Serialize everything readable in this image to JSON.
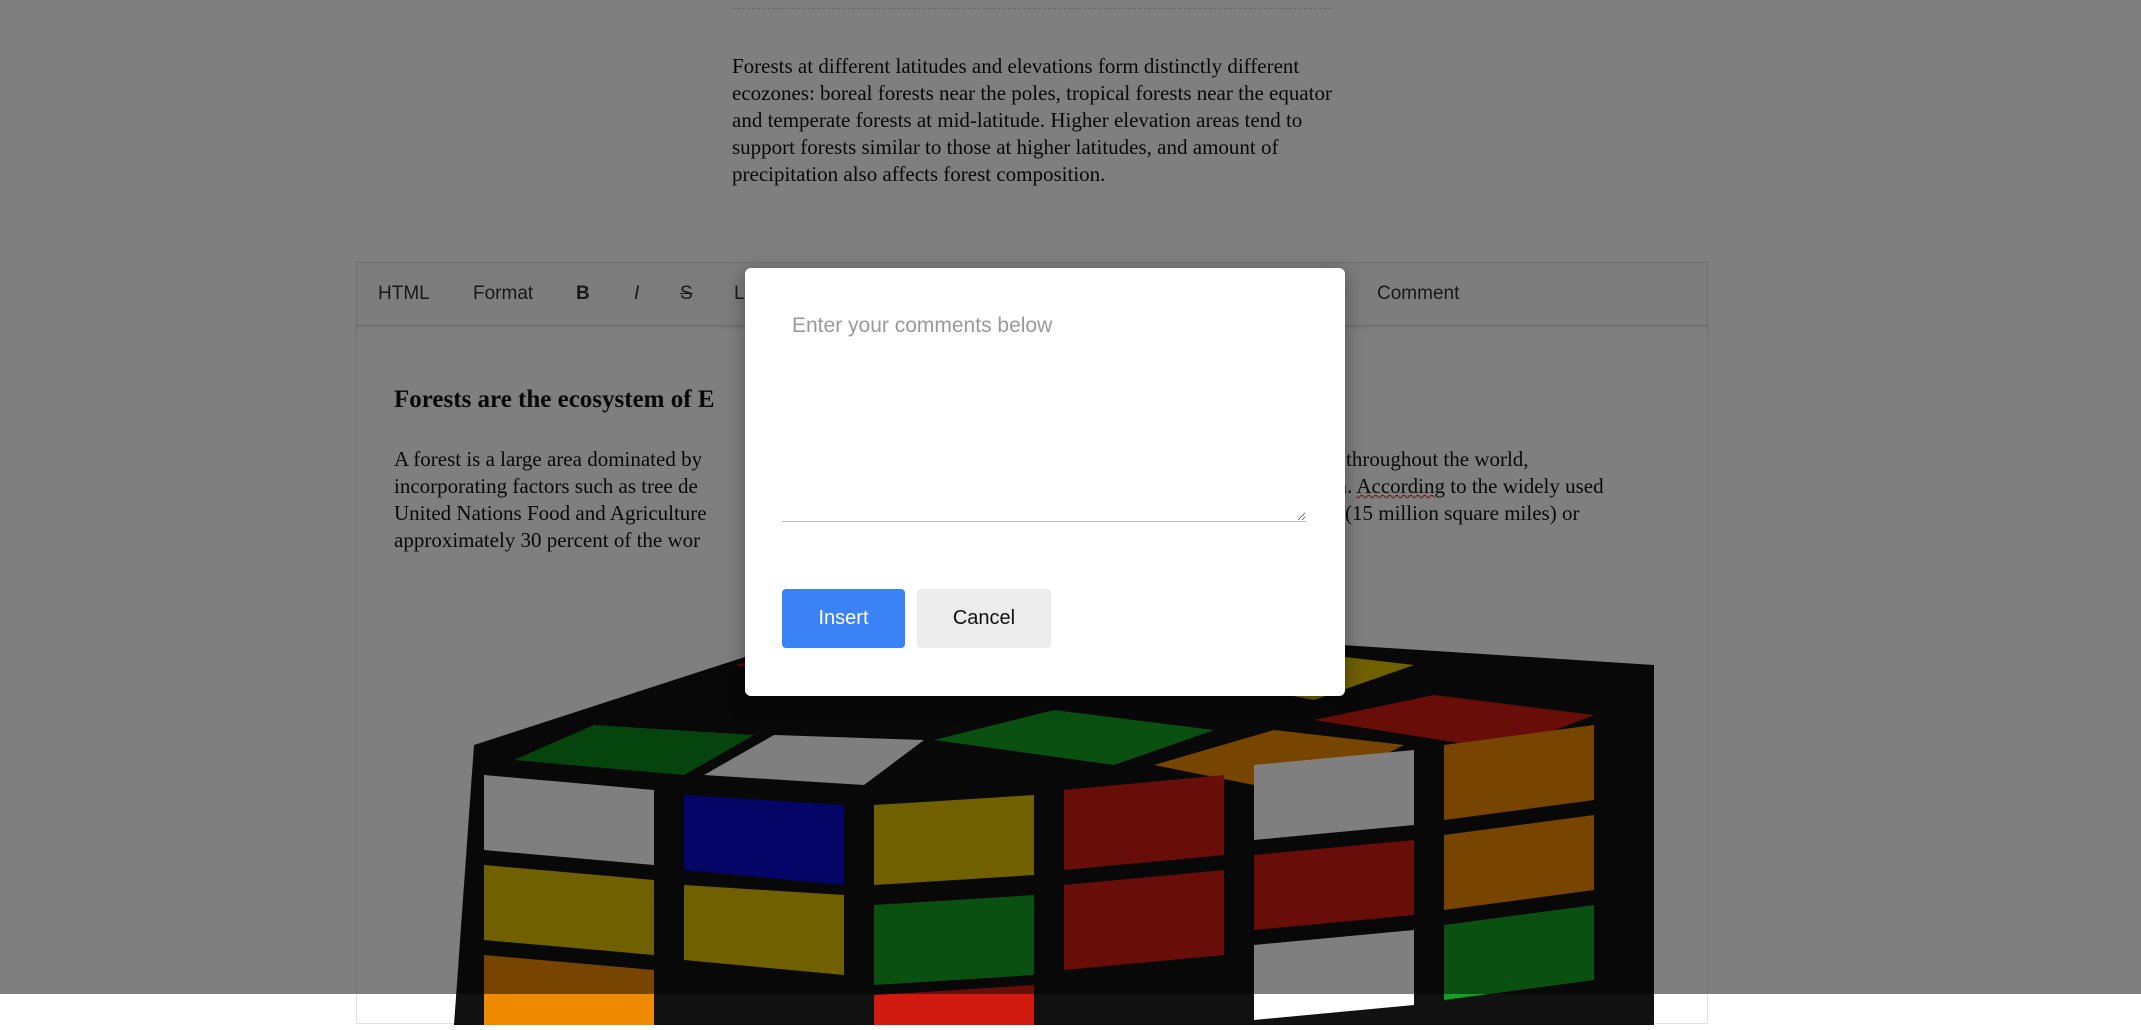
{
  "intro_paragraph": "Forests at different latitudes and elevations form distinctly different ecozones: boreal forests near the poles, tropical forests near the equator and temperate forests at mid-latitude. Higher elevation areas tend to support forests similar to those at higher latitudes, and amount of precipitation also affects forest composition.",
  "toolbar": {
    "html": "HTML",
    "format": "Format",
    "bold": "B",
    "italic": "I",
    "strike": "S",
    "partial": "L",
    "comment": "Comment"
  },
  "editor": {
    "heading": "Forests are the ecosystem of E",
    "line1_left": "A forest is a large area dominated by",
    "line1_right": "throughout the world,",
    "line2_left": "incorporating factors such as tree de",
    "line2_right_pre": "on. ",
    "line2_right_misspelled": "According",
    "line2_right_post": " to the widely used",
    "line3_left": "United Nations Food and Agriculture",
    "line3_right": "(15 million square miles) or",
    "line4_left": "approximately 30 percent of the wor"
  },
  "modal": {
    "placeholder": "Enter your comments below",
    "insert_label": "Insert",
    "cancel_label": "Cancel"
  }
}
